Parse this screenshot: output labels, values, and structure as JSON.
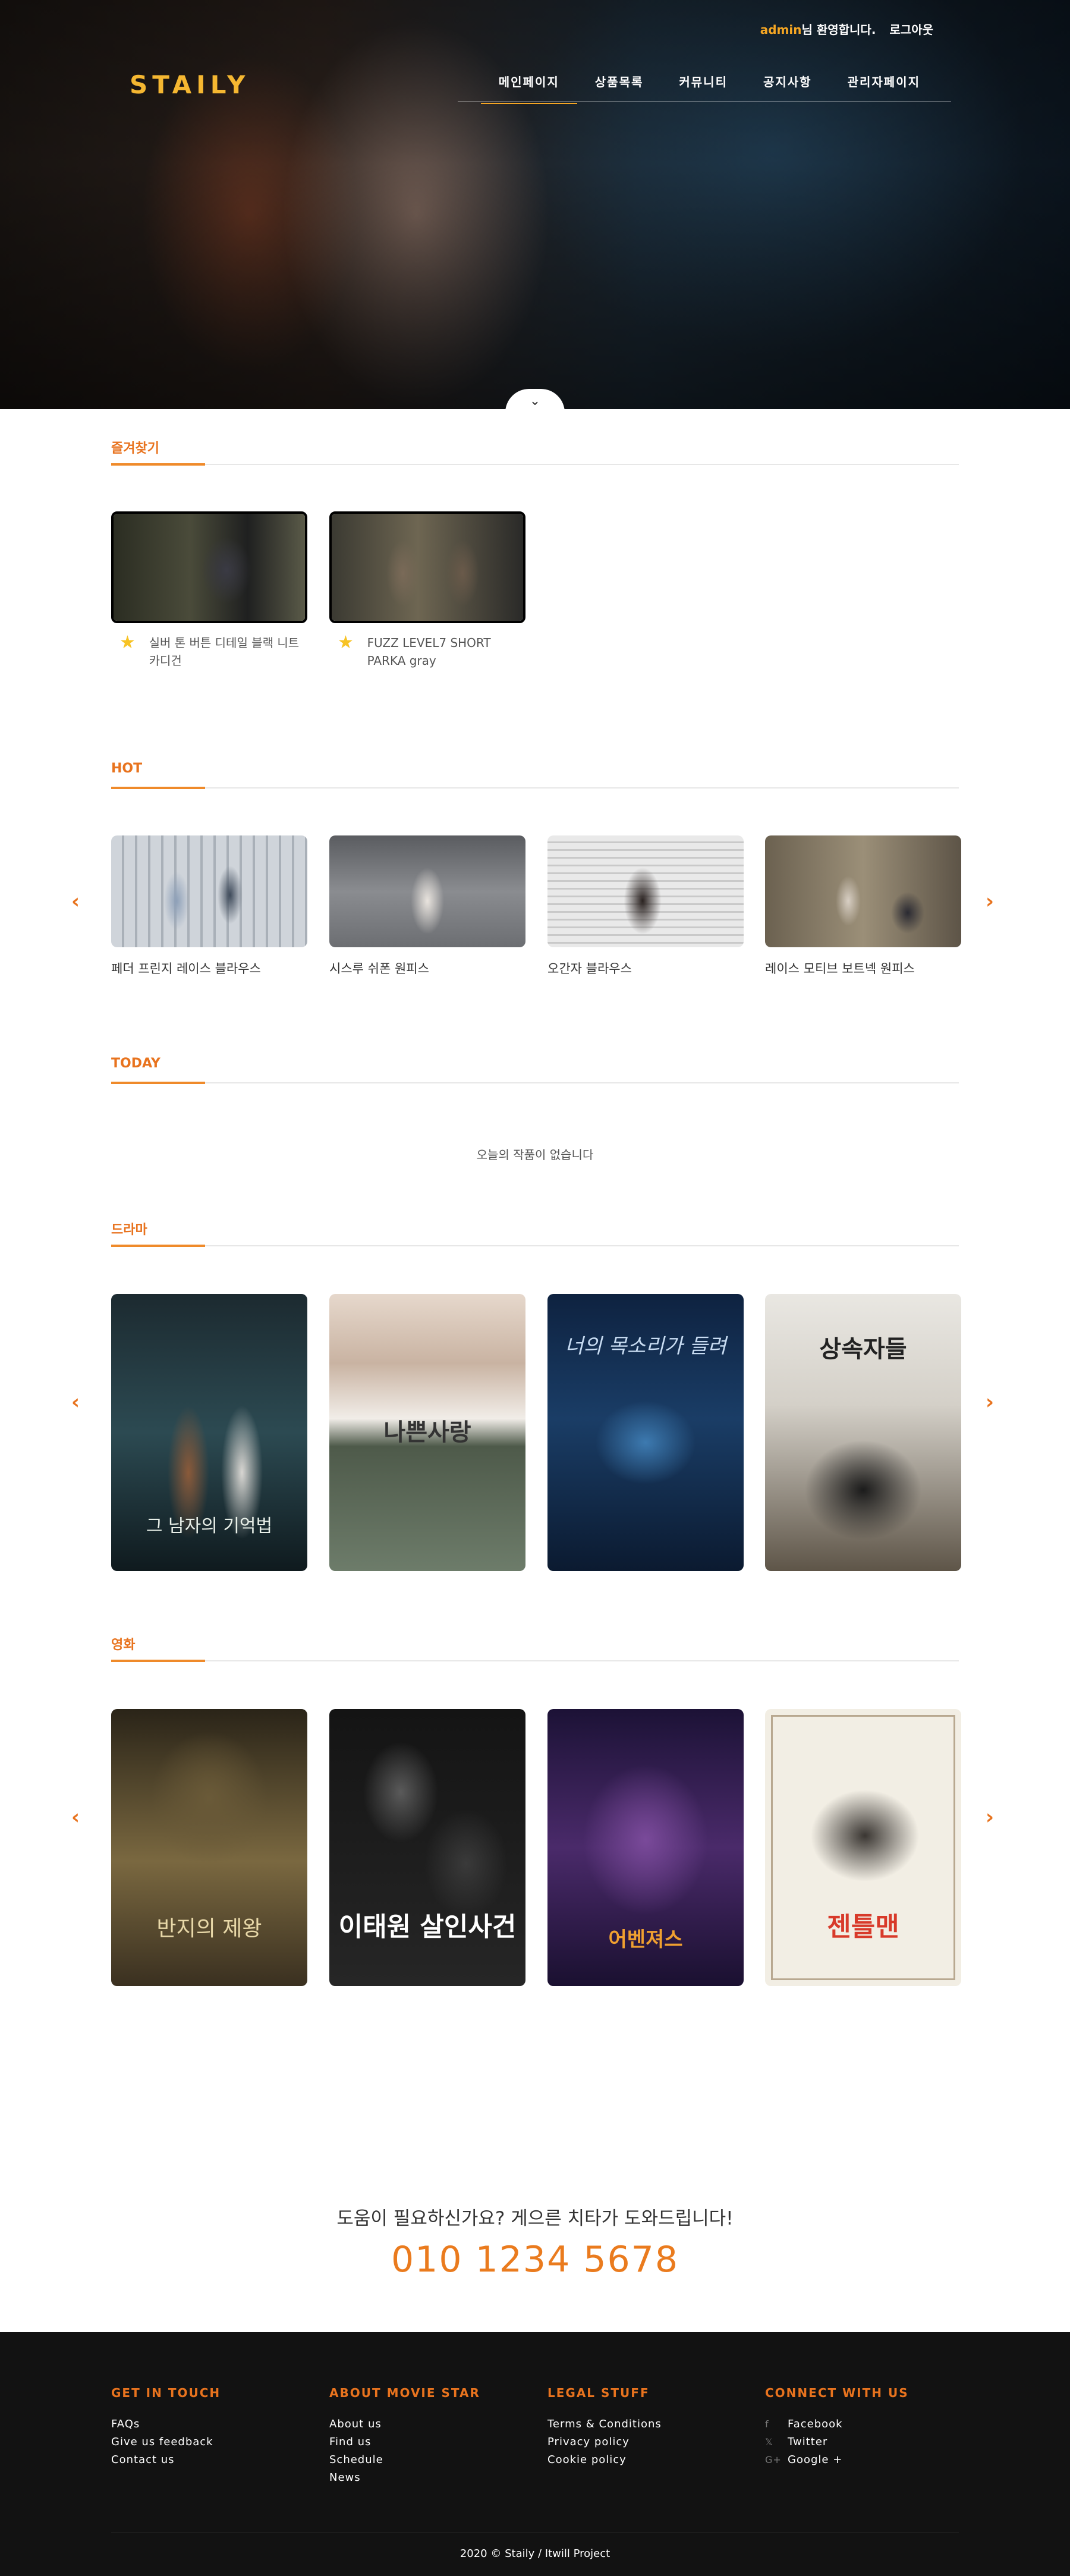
{
  "header": {
    "user": "admin",
    "welcome": "님 환영합니다.",
    "logout": "로그아웃",
    "logo": "STAILY",
    "nav": [
      "메인페이지",
      "상품목록",
      "커뮤니티",
      "공지사항",
      "관리자페이지"
    ],
    "scroll_icon": "chevron-down-icon"
  },
  "favorites": {
    "title": "즐겨찾기",
    "items": [
      {
        "label": "실버 톤 버튼 디테일 블랙 니트 카디건"
      },
      {
        "label": "FUZZ LEVEL7 SHORT PARKA gray"
      }
    ]
  },
  "hot": {
    "title": "HOT",
    "items": [
      {
        "label": "페더 프린지 레이스 블라우스"
      },
      {
        "label": "시스루 쉬폰 원피스"
      },
      {
        "label": "오간자 블라우스"
      },
      {
        "label": "레이스 모티브 보트넥 원피스"
      }
    ]
  },
  "today": {
    "title": "TODAY",
    "empty": "오늘의 작품이 없습니다"
  },
  "drama": {
    "title": "드라마",
    "posters": [
      {
        "text": "그 남자의 기억법"
      },
      {
        "text": "나쁜사랑"
      },
      {
        "text": "너의 목소리가 들려"
      },
      {
        "text": "상속자들"
      }
    ]
  },
  "movie": {
    "title": "영화",
    "posters": [
      {
        "text": "반지의 제왕"
      },
      {
        "text": "이태원 살인사건"
      },
      {
        "text": "어벤져스"
      },
      {
        "text": "젠틀맨"
      }
    ]
  },
  "arrows": {
    "prev": "‹",
    "next": "›"
  },
  "help": {
    "question": "도움이 필요하신가요? 게으른 치타가 도와드립니다!",
    "phone": "010 1234 5678"
  },
  "footer": {
    "columns": [
      {
        "title": "GET IN TOUCH",
        "links": [
          "FAQs",
          "Give us feedback",
          "Contact us"
        ]
      },
      {
        "title": "ABOUT MOVIE STAR",
        "links": [
          "About us",
          "Find us",
          "Schedule",
          "News"
        ]
      },
      {
        "title": "LEGAL STUFF",
        "links": [
          "Terms & Conditions",
          "Privacy policy",
          "Cookie policy"
        ]
      },
      {
        "title": "CONNECT WITH US",
        "links": [
          "Facebook",
          "Twitter",
          "Google +"
        ]
      }
    ],
    "copyright": "2020 © Staily / Itwill Project"
  },
  "colors": {
    "accent": "#e8731e",
    "logo": "#f5b731",
    "footer_bg": "#121212"
  }
}
